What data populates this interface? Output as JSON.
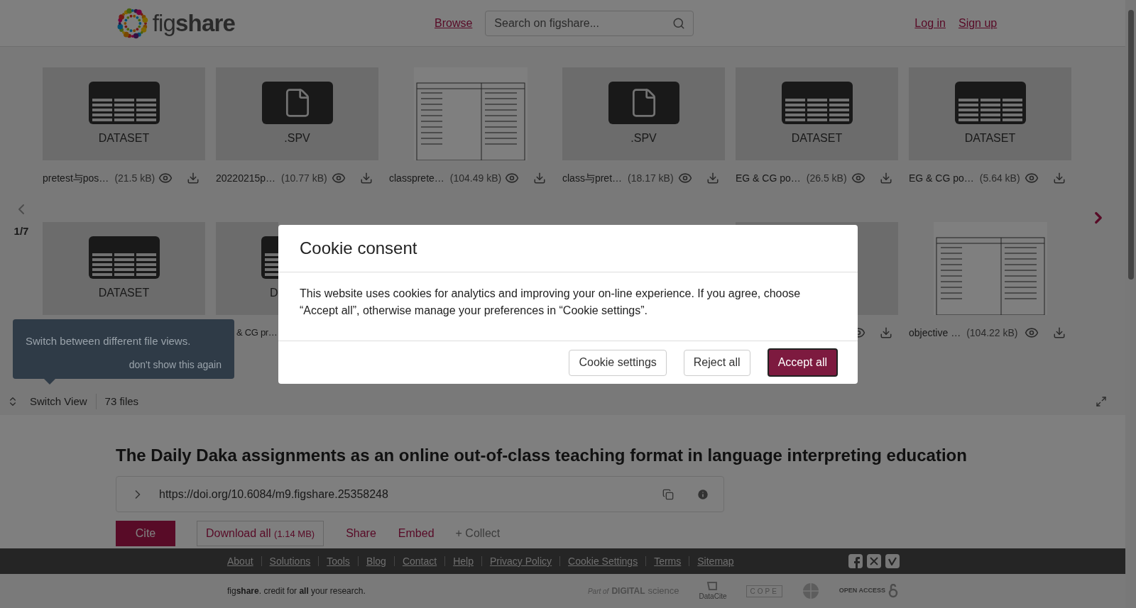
{
  "header": {
    "logo": "fig**share**",
    "browse": "Browse",
    "search": {
      "placeholder": "Search on figshare..."
    },
    "login": "Log in",
    "signup": "Sign up"
  },
  "files": {
    "pager": "1/7",
    "rows": [
      [
        {
          "kind": "dataset",
          "label": "DATASET",
          "name": "pretest与pos…",
          "size": "(21.5 kB)"
        },
        {
          "kind": "file",
          "label": ".SPV",
          "name": "20220215p…",
          "size": "(10.77 kB)"
        },
        {
          "kind": "image",
          "name": "classprete…",
          "size": "(104.49 kB)"
        },
        {
          "kind": "file",
          "label": ".SPV",
          "name": "class与pret…",
          "size": "(18.17 kB)"
        },
        {
          "kind": "dataset",
          "label": "DATASET",
          "name": "EG & CG po…",
          "size": "(26.5 kB)"
        },
        {
          "kind": "dataset",
          "label": "DATASET",
          "name": "EG & CG po…",
          "size": "(5.64 kB)"
        }
      ],
      [
        {
          "kind": "dataset",
          "label": "DATASET"
        },
        {
          "kind": "partial",
          "label": "D",
          "name": "& CG pr…"
        },
        {
          "kind": "hidden"
        },
        {
          "kind": "hidden"
        },
        {
          "kind": "icons"
        },
        {
          "kind": "image",
          "name": "objective …",
          "size": "(104.22 kB)"
        }
      ]
    ],
    "tooltip": {
      "text": "Switch between different file views.",
      "dismiss": "don't show this again"
    },
    "switch_view": "Switch View",
    "count": "73 files"
  },
  "article": {
    "title": "The Daily Daka assignments as an online out-of-class teaching format in language interpreting education",
    "doi": "https://doi.org/10.6084/m9.figshare.25358248",
    "cite": "Cite",
    "download": "Download all",
    "download_size": "(1.14 MB)",
    "share": "Share",
    "embed": "Embed",
    "collect": "+ Collect"
  },
  "footer": {
    "links": [
      "About",
      "Solutions",
      "Tools",
      "Blog",
      "Contact",
      "Help",
      "Privacy Policy",
      "Cookie Settings",
      "Terms",
      "Sitemap"
    ],
    "tagline": "fig**share**. credit for **all** your research.",
    "partners": [
      {
        "kind": "ds",
        "prefix": "Part of",
        "text": "DIGITAL",
        "suffix": "science"
      },
      {
        "kind": "datacite",
        "text": "DataCite"
      },
      {
        "kind": "cope",
        "text": "COPE"
      },
      {
        "kind": "globe"
      },
      {
        "kind": "oa",
        "text": "OPEN ACCESS"
      }
    ]
  },
  "cookie": {
    "title": "Cookie consent",
    "body": "This website uses cookies for analytics and improving your on-line experience. If you agree, choose “Accept all”, otherwise manage your preferences in “Cookie settings”.",
    "buttons": [
      {
        "kind": "secondary",
        "label": "Cookie settings"
      },
      {
        "kind": "secondary",
        "label": "Reject all"
      },
      {
        "kind": "primary",
        "label": "Accept all"
      }
    ]
  }
}
